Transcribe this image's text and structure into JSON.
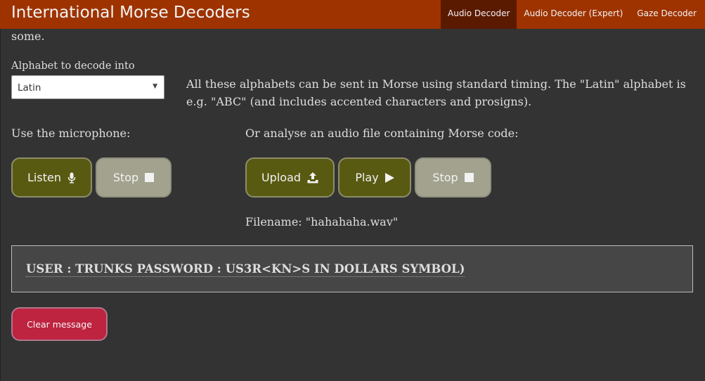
{
  "app": {
    "title": "International Morse Decoders"
  },
  "nav": {
    "items": [
      {
        "label": "Audio Decoder",
        "active": true
      },
      {
        "label": "Audio Decoder (Expert)",
        "active": false
      },
      {
        "label": "Gaze Decoder",
        "active": false
      }
    ]
  },
  "intro_tail": "some.",
  "alphabet": {
    "label": "Alphabet to decode into",
    "selected": "Latin",
    "info": "All these alphabets can be sent in Morse using standard timing. The \"Latin\" alphabet is e.g. \"ABC\" (and includes accented characters and prosigns)."
  },
  "mic": {
    "heading": "Use the microphone:",
    "listen_label": "Listen",
    "stop_label": "Stop"
  },
  "file": {
    "heading": "Or analyse an audio file containing Morse code:",
    "upload_label": "Upload",
    "play_label": "Play",
    "stop_label": "Stop",
    "filename_text": "Filename: \"hahahaha.wav\""
  },
  "output": {
    "message": "USER : TRUNKS PASSWORD : US3R<KN>S IN DOLLARS SYMBOL)"
  },
  "actions": {
    "clear_label": "Clear message"
  },
  "colors": {
    "topbar": "#9e3300",
    "nav_active": "#5a1a00",
    "background": "#333333",
    "button_olive": "#595a12",
    "button_disabled": "#a2a28e",
    "clear_button": "#be2340"
  },
  "icons": {
    "listen": "microphone-icon",
    "stop": "stop-square-icon",
    "upload": "upload-icon",
    "play": "play-triangle-icon",
    "select": "chevron-down-icon"
  }
}
